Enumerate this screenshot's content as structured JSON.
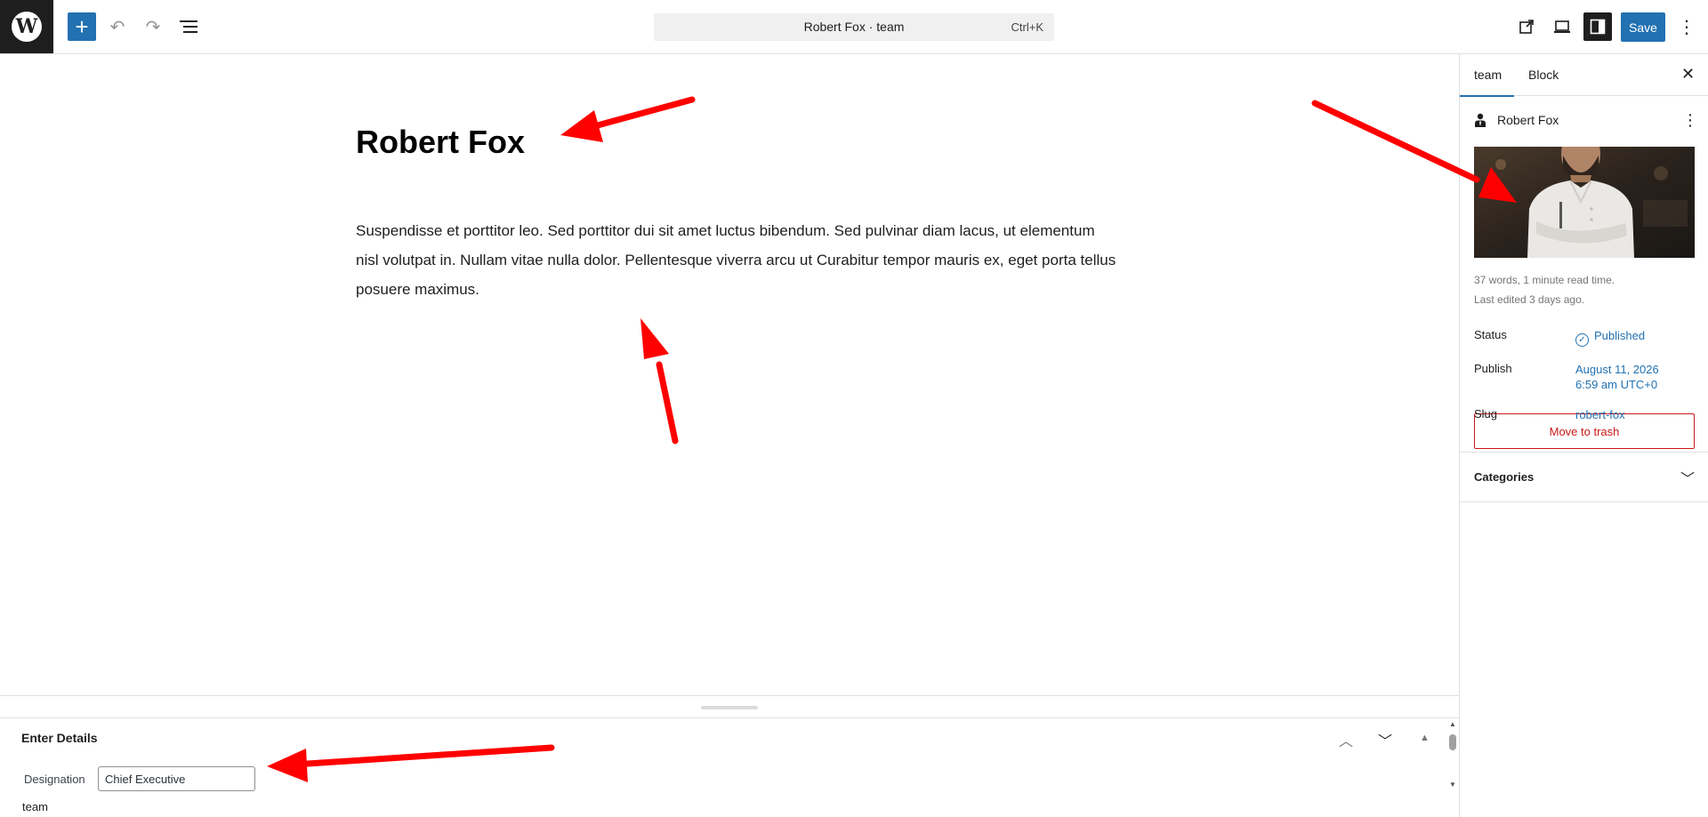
{
  "topbar": {
    "command_title": "Robert Fox · team",
    "command_shortcut": "Ctrl+K",
    "save_label": "Save",
    "icons": [
      "wordpress-logo",
      "plus-icon",
      "undo-icon",
      "redo-icon",
      "list-view-icon",
      "external-view-icon",
      "device-preview-icon",
      "settings-sidebar-icon",
      "more-vertical-icon"
    ]
  },
  "post": {
    "title": "Robert Fox",
    "content": "Suspendisse et porttitor leo. Sed porttitor dui sit amet luctus bibendum. Sed pulvinar diam lacus, ut elementum nisl volutpat in. Nullam vitae nulla dolor. Pellentesque viverra arcu ut Curabitur tempor mauris ex, eget porta tellus posuere maximus."
  },
  "sidebar": {
    "tabs": [
      {
        "label": "team",
        "active": true
      },
      {
        "label": "Block",
        "active": false
      }
    ],
    "post_name": "Robert Fox",
    "stats_line1": "37 words, 1 minute read time.",
    "stats_line2": "Last edited 3 days ago.",
    "status_label": "Status",
    "status_value": "Published",
    "publish_label": "Publish",
    "publish_date": "August 11, 2026",
    "publish_time": "6:59 am UTC+0",
    "slug_label": "Slug",
    "slug_value": "robert-fox",
    "trash_label": "Move to trash",
    "categories_label": "Categories"
  },
  "metabox": {
    "title": "Enter Details",
    "designation_label": "Designation",
    "designation_value": "Chief Executive"
  },
  "footer": {
    "breadcrumb": "team"
  },
  "colors": {
    "accent": "#2271b1",
    "danger": "#cc1818",
    "annotation": "#ff0000"
  }
}
